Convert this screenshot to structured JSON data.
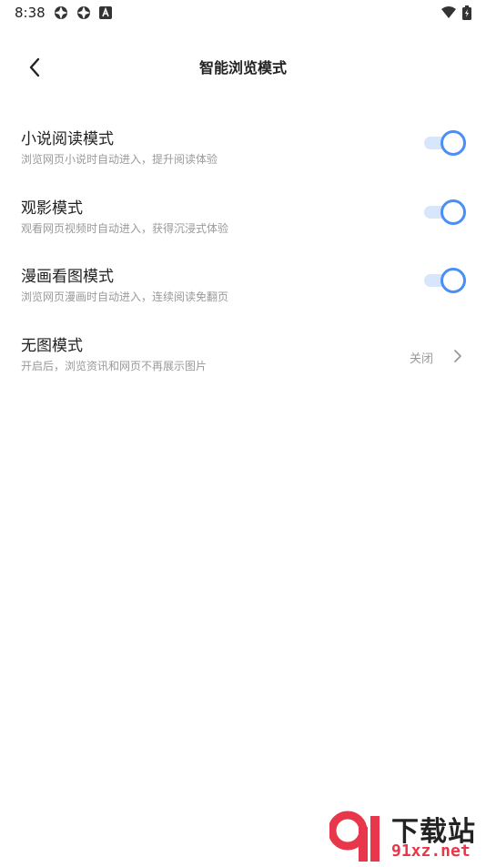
{
  "status_bar": {
    "time": "8:38"
  },
  "header": {
    "title": "智能浏览模式"
  },
  "settings": [
    {
      "title": "小说阅读模式",
      "description": "浏览网页小说时自动进入，提升阅读体验",
      "enabled": true
    },
    {
      "title": "观影模式",
      "description": "观看网页视频时自动进入，获得沉浸式体验",
      "enabled": true
    },
    {
      "title": "漫画看图模式",
      "description": "浏览网页漫画时自动进入，连续阅读免翻页",
      "enabled": true
    },
    {
      "title": "无图模式",
      "description": "开启后，浏览资讯和网页不再展示图片",
      "value": "关闭"
    }
  ],
  "watermark": {
    "title": "下载站",
    "site": "91xz.net"
  },
  "colors": {
    "accent": "#4a8ff6",
    "track": "#d8e6fb",
    "watermark_red": "#e8374a"
  }
}
